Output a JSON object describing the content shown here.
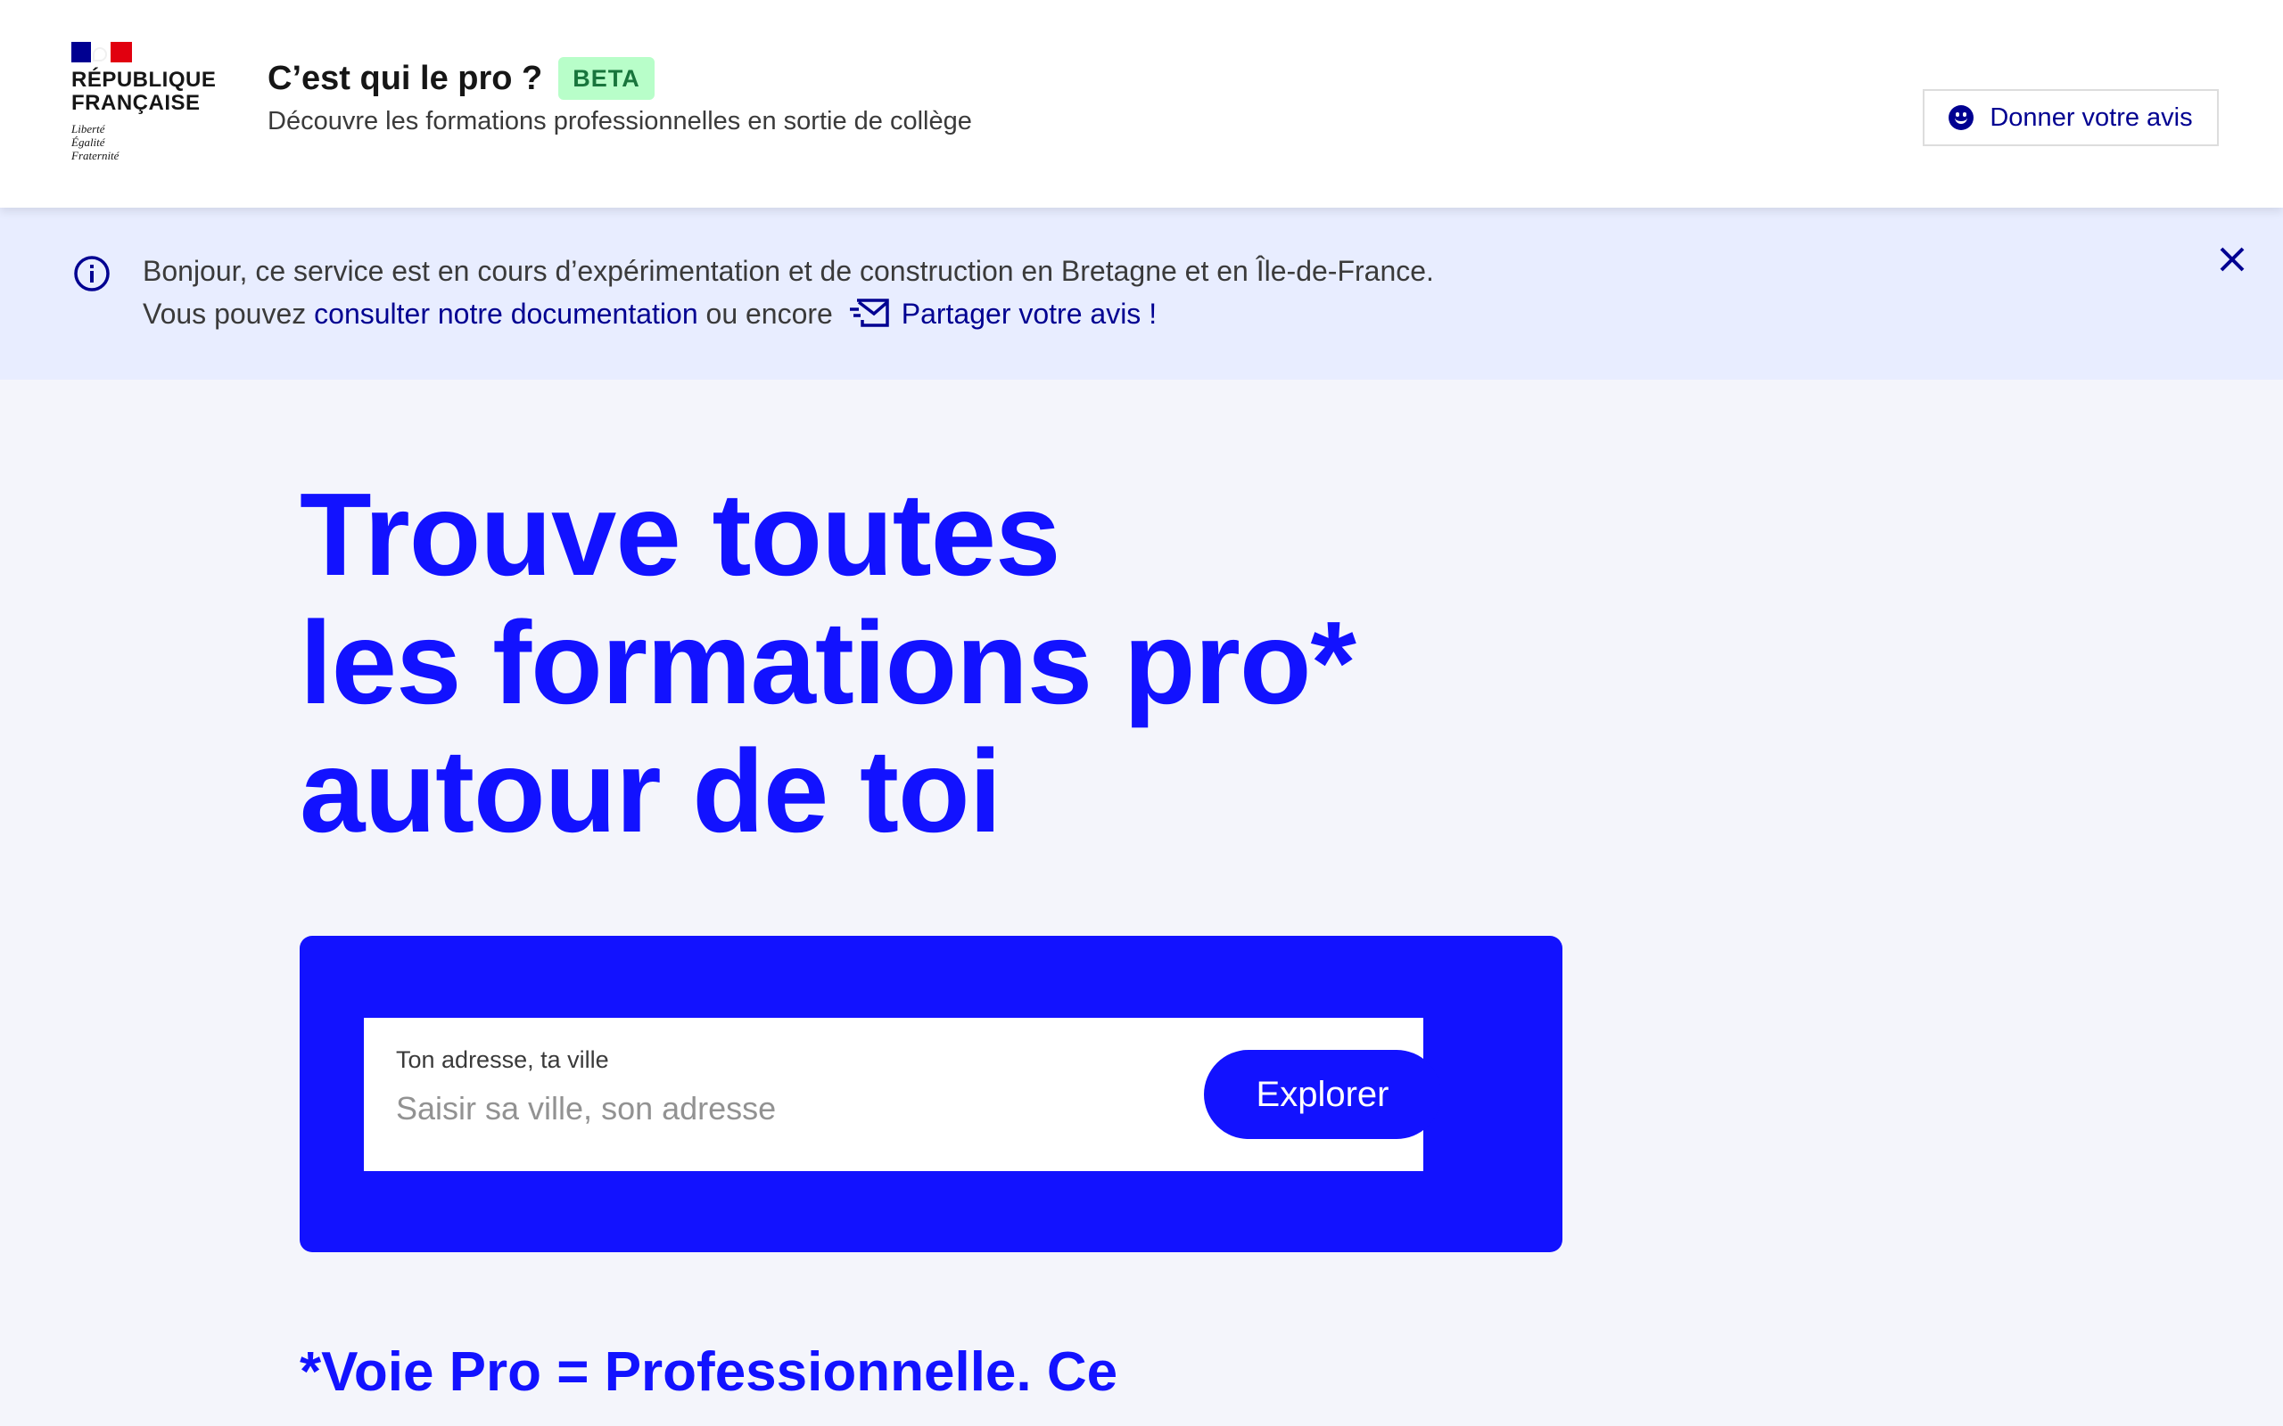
{
  "header": {
    "logo": {
      "line1": "RÉPUBLIQUE",
      "line2": "FRANÇAISE",
      "motto": [
        "Liberté",
        "Égalité",
        "Fraternité"
      ]
    },
    "service_title": "C’est qui le pro ?",
    "badge": "BETA",
    "tagline": "Découvre les formations professionnelles en sortie de collège",
    "feedback_button": "Donner votre avis",
    "feedback_icon": "smile-icon"
  },
  "notice": {
    "line1": "Bonjour, ce service est en cours d’expérimentation et de construction en Bretagne et en Île-de-France.",
    "line2_prefix": "Vous pouvez ",
    "doc_link": "consulter notre documentation",
    "line2_middle": " ou encore ",
    "share_link": "Partager votre avis !",
    "icons": [
      "info-icon",
      "mail-icon",
      "close-icon"
    ]
  },
  "hero": {
    "title_lines": [
      "Trouve toutes",
      "les formations pro*",
      "autour de toi"
    ]
  },
  "search": {
    "label": "Ton adresse, ta ville",
    "placeholder": "Saisir sa ville, son adresse",
    "value": "",
    "button": "Explorer"
  },
  "footnote": "*Voie Pro = Professionnelle. Ce",
  "colors": {
    "primary_blue": "#000091",
    "hero_blue": "#1212ff",
    "notice_bg": "#e8edff",
    "page_bg": "#f4f5fb",
    "beta_bg": "#b8fec9",
    "beta_text": "#18753c"
  }
}
